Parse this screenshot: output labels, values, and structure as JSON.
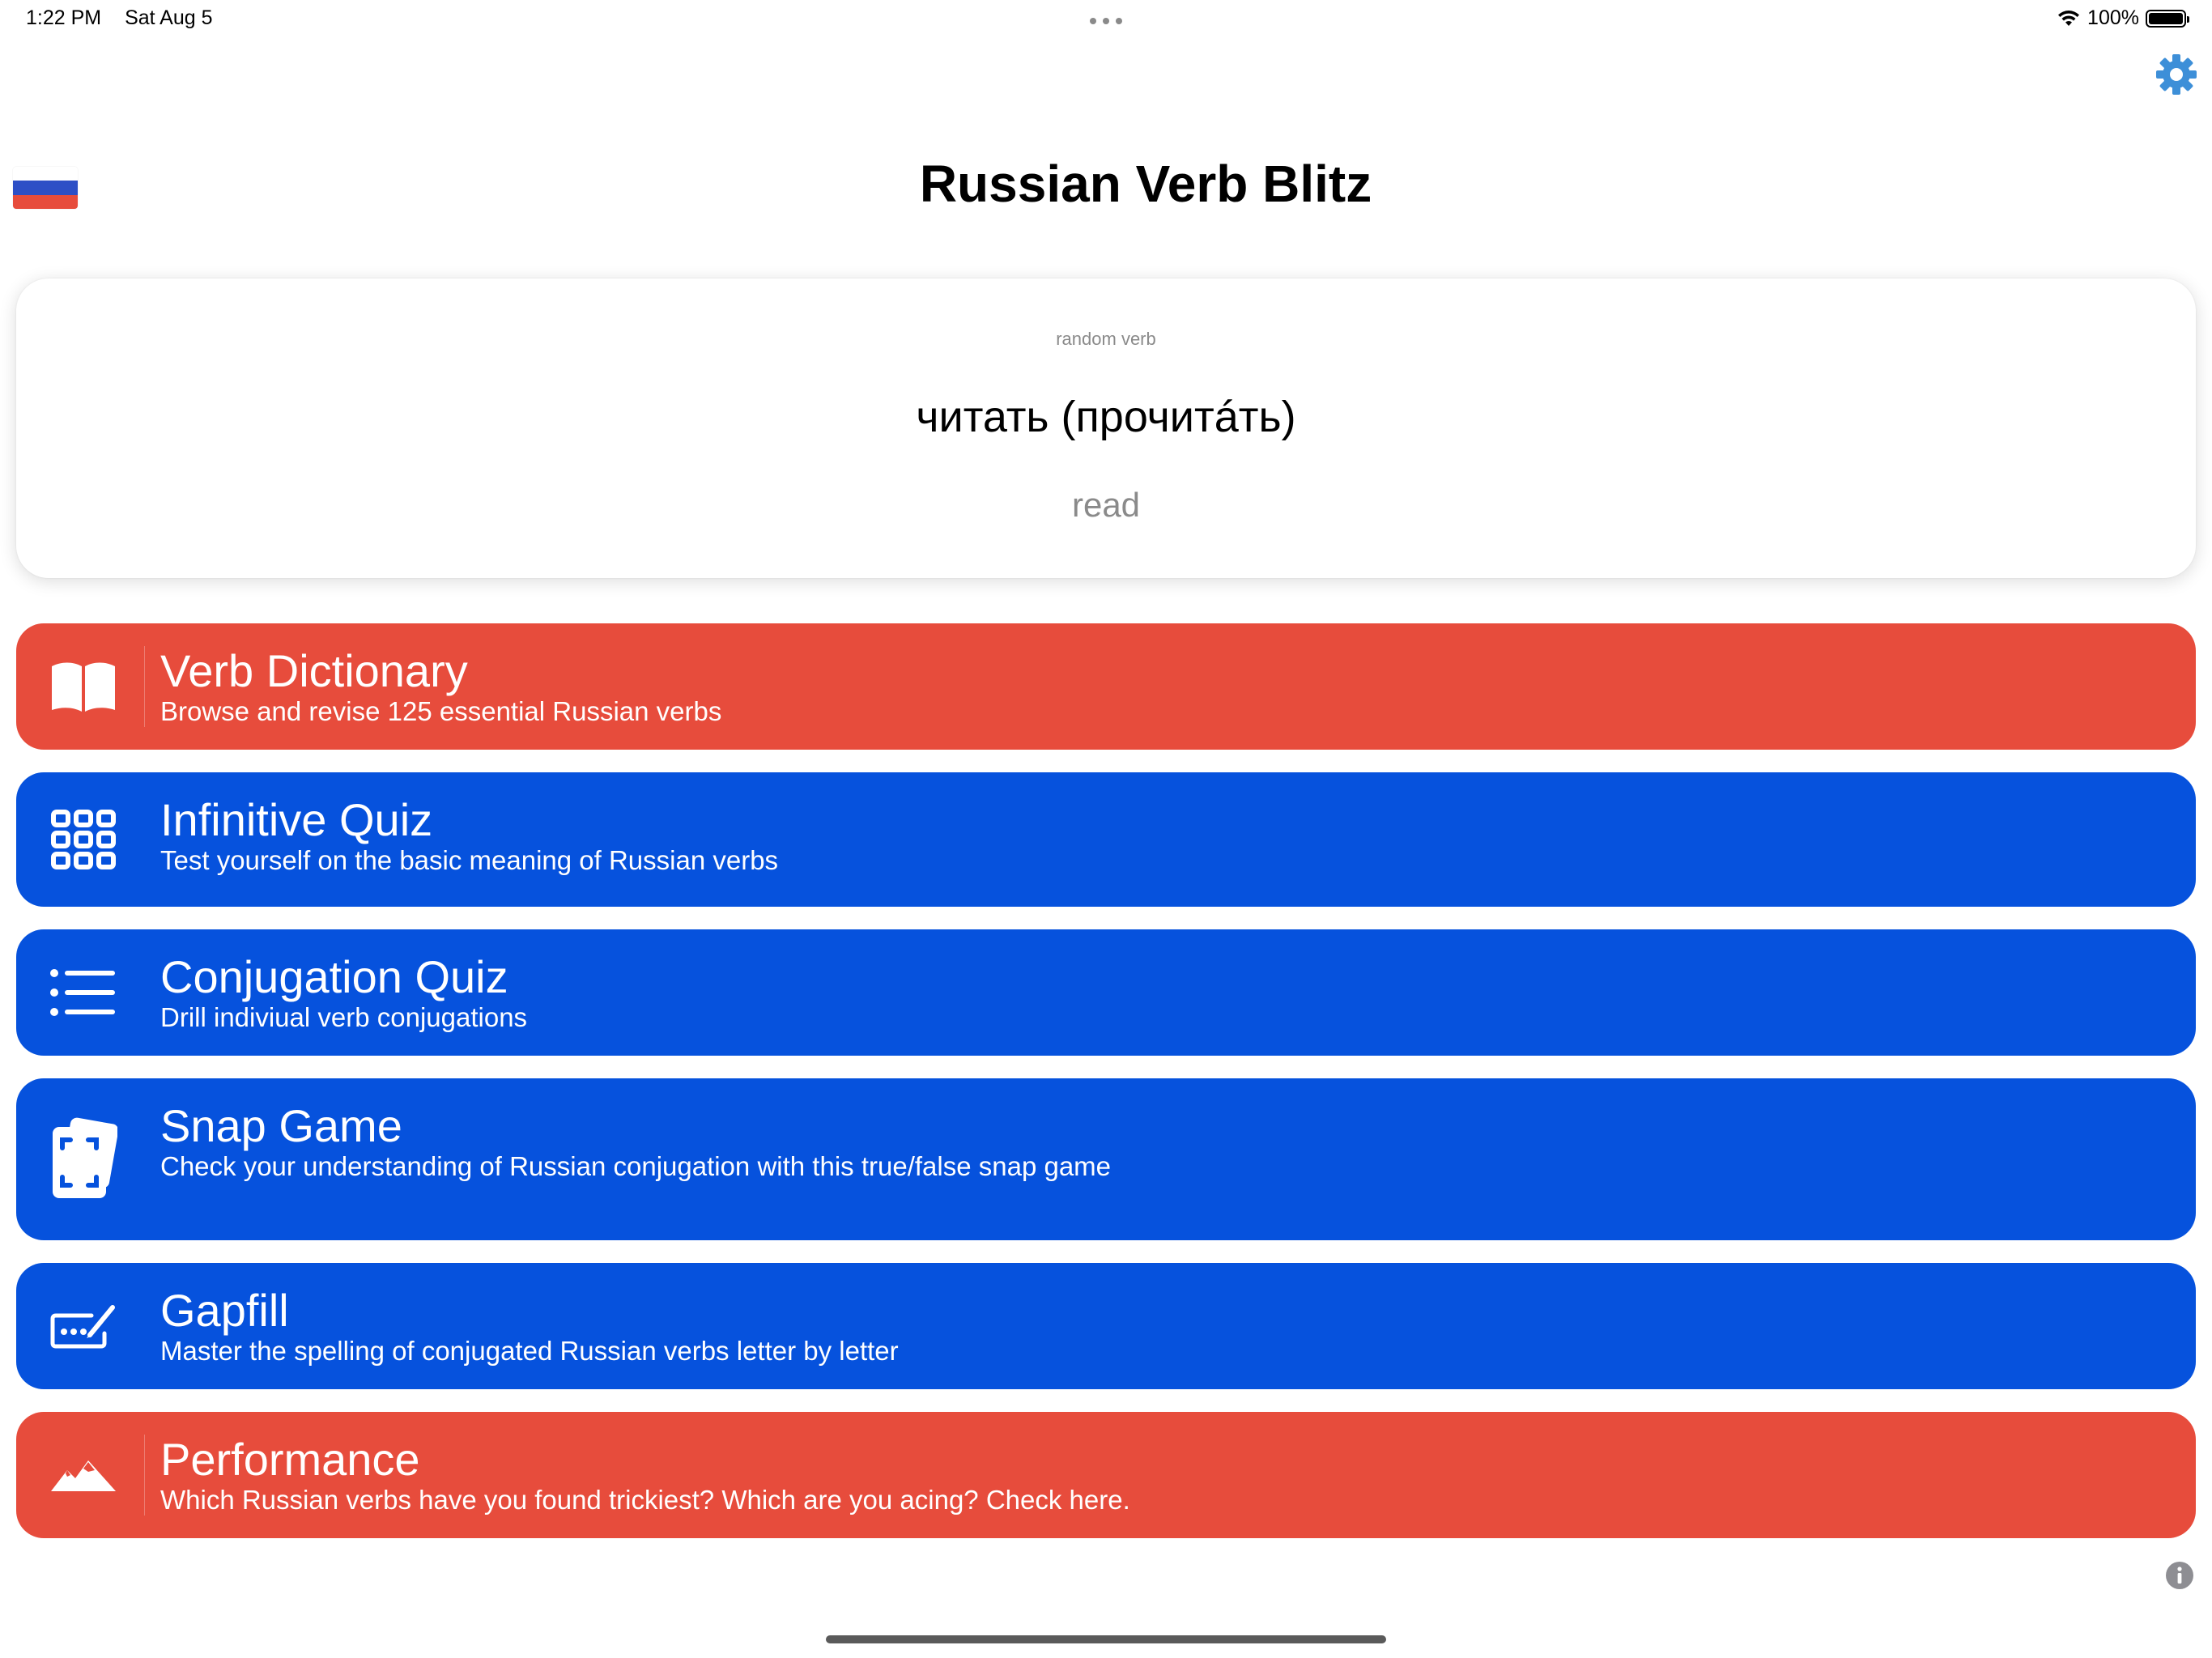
{
  "status_bar": {
    "time": "1:22 PM",
    "date": "Sat Aug 5",
    "battery": "100%",
    "icons": [
      "wifi-icon",
      "battery-icon"
    ]
  },
  "header": {
    "title": "Russian Verb Blitz",
    "flag_colors": [
      "#ffffff",
      "#2d4fc6",
      "#e74c3c"
    ],
    "settings_icon": "gear-icon"
  },
  "random_verb": {
    "caption": "random verb",
    "verb": "читать (прочитáть)",
    "meaning": "read"
  },
  "menu": [
    {
      "title": "Verb Dictionary",
      "subtitle": "Browse and revise 125 essential Russian verbs",
      "icon": "book-icon",
      "color": "#e74c3c"
    },
    {
      "title": "Infinitive Quiz",
      "subtitle": "Test yourself on the basic meaning of Russian verbs",
      "icon": "grid-icon",
      "color": "#0652dd"
    },
    {
      "title": "Conjugation Quiz",
      "subtitle": "Drill indiviual verb conjugations",
      "icon": "list-icon",
      "color": "#0652dd"
    },
    {
      "title": "Snap Game",
      "subtitle": "Check your understanding of Russian conjugation with this true/false snap game",
      "icon": "cards-icon",
      "color": "#0652dd"
    },
    {
      "title": "Gapfill",
      "subtitle": "Master the spelling of conjugated Russian verbs letter by letter",
      "icon": "text-input-icon",
      "color": "#0652dd"
    },
    {
      "title": "Performance",
      "subtitle": "Which Russian verbs have you found trickiest? Which are you acing? Check here.",
      "icon": "mountains-icon",
      "color": "#e74c3c"
    }
  ],
  "footer": {
    "info_icon": "info-icon"
  }
}
